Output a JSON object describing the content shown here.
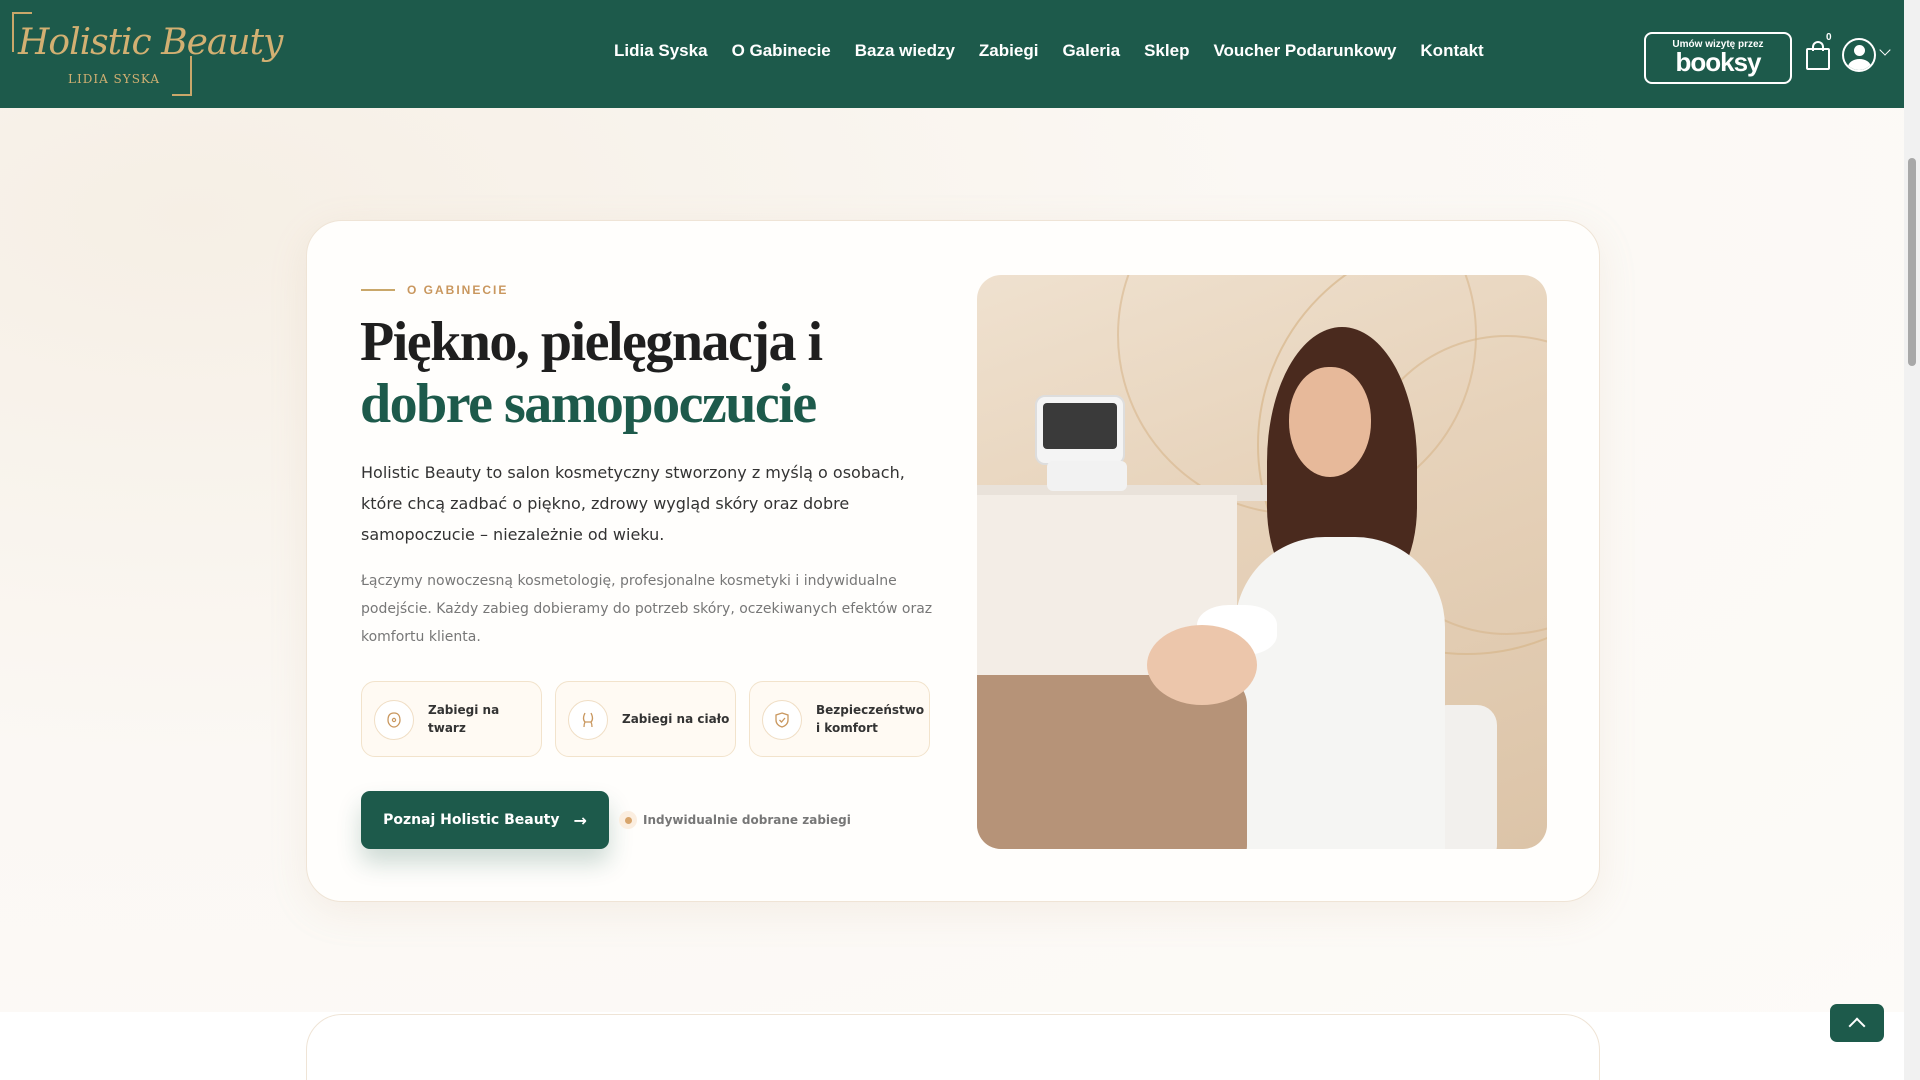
{
  "header": {
    "logo": {
      "script": "Holistic Beauty",
      "sub": "LIDIA SYSKA"
    },
    "nav": [
      "Lidia Syska",
      "O Gabinecie",
      "Baza wiedzy",
      "Zabiegi",
      "Galeria",
      "Sklep",
      "Voucher Podarunkowy",
      "Kontakt"
    ],
    "booksy": {
      "small": "Umów wizytę przez",
      "big": "booksy"
    },
    "cart_count": "0"
  },
  "about": {
    "eyebrow": "O GABINECIE",
    "title_part1": "Piękno, pielęgnacja i ",
    "title_accent": "dobre samopoczucie",
    "lead": "Holistic Beauty to salon kosmetyczny stworzony z myślą o osobach, które chcą zadbać o piękno, zdrowy wygląd skóry oraz dobre samopoczucie – niezależnie od wieku.",
    "paragraph": "Łączymy nowoczesną kosmetologię, profesjonalne kosmetyki i indywidualne podejście. Każdy zabieg dobieramy do potrzeb skóry, oczekiwanych efektów oraz komfortu klienta.",
    "features": [
      {
        "label": "Zabiegi na twarz",
        "icon": "face-icon"
      },
      {
        "label": "Zabiegi na ciało",
        "icon": "body-icon"
      },
      {
        "label": "Bezpieczeństwo i komfort",
        "icon": "shield-icon"
      }
    ],
    "cta": "Poznaj Holistic Beauty",
    "note": "Indywidualnie dobrane zabiegi"
  },
  "colors": {
    "brand": "#1d5a4b",
    "gold": "#c9975e",
    "background": "#fbf7f2"
  }
}
